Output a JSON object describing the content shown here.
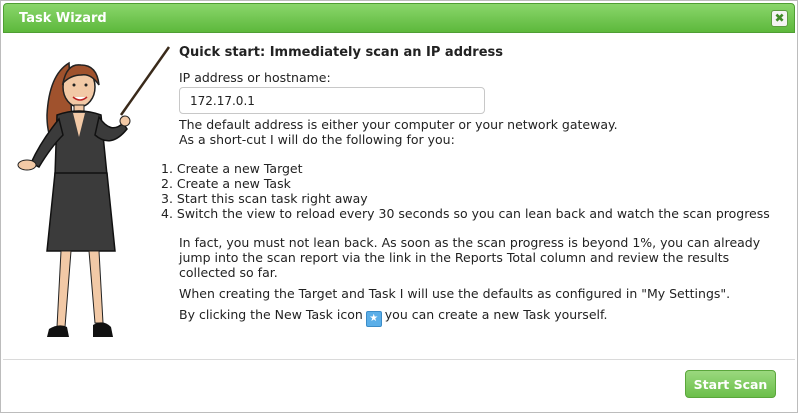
{
  "dialog": {
    "title": "Task Wizard",
    "close_glyph": "✖",
    "heading": "Quick start: Immediately scan an IP address",
    "ip_label": "IP address or hostname:",
    "ip_value": "172.17.0.1",
    "intro_1": "The default address is either your computer or your network gateway.",
    "intro_2": "As a short-cut I will do the following for you:",
    "steps": [
      "1. Create a new Target",
      "2. Create a new Task",
      "3. Start this scan task right away",
      "4. Switch the view to reload every 30 seconds so you can lean back and watch the scan progress"
    ],
    "note_1": "In fact, you must not lean back. As soon as the scan progress is beyond 1%, you can already jump into the scan report via the link in the Reports Total column and review the results collected so far.",
    "note_2": "When creating the Target and Task I will use the defaults as configured in \"My Settings\".",
    "note_3_before": "By clicking the New Task icon",
    "note_3_after": "you can create a new Task yourself.",
    "new_task_icon": "star-icon",
    "submit_label": "Start Scan"
  },
  "colors": {
    "titlebar": "#5db83c",
    "button": "#6bbf4a"
  }
}
